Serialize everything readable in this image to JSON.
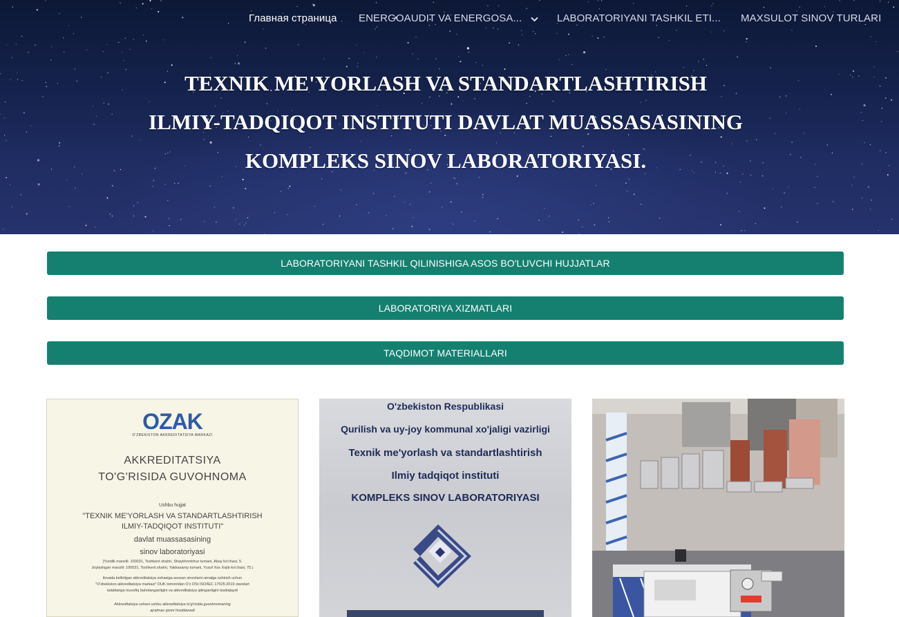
{
  "nav": {
    "items": [
      {
        "label": "Главная страница",
        "active": true
      },
      {
        "label": "ENERGOAUDIT VA ENERGOSA...",
        "dropdown": true
      },
      {
        "label": "LABORATORIYANI TASHKIL ETI..."
      },
      {
        "label": "MAXSULOT SINOV TURLARI"
      }
    ]
  },
  "hero": {
    "title_lines": [
      "TEXNIK ME'YORLASH VA STANDARTLASHTIRISH",
      "ILMIY-TADQIQOT INSTITUTI DAVLAT MUASSASASINING",
      "KOMPLEKS SINOV LABORATORIYASI."
    ]
  },
  "buttons": [
    "LABORATORIYANI TASHKIL QILINISHIGA ASOS BO'LUVCHI HUJJATLAR",
    "LABORATORIYA XIZMATLARI",
    "TAQDIMOT MATERIALLARI"
  ],
  "card_cert": {
    "logo": "OZAK",
    "logo_sub": "O'ZBEKISTON AKKREDITATSIYA MARKAZI",
    "title_1": "AKKREDITATSIYA",
    "title_2": "TO'G'RISIDA GUVOHNOMA",
    "line_1": "Ushbu hujjat",
    "line_2": "\"TEXNIK ME'YORLASH VA STANDARTLASHTIRISH",
    "line_3": "ILMIY-TADQIQOT INSTITUTI\"",
    "line_4": "davlat muassasasining",
    "line_5": "sinov laboratoriyasi",
    "line_6": "(Yuridik manzili: 100031, Toshkent shahri, Shaykhontohur tumani, Abay ko'chasi, 5.",
    "line_7": "Joylashgan manzili: 100031, Toshkent shahri, Yakkasaroy tumani, Yusuf Xos Xojib ko'chasi, 75.)",
    "line_8": "ilovada keltirilgan akkreditatsiya sohasiga asosan sinovlarni amalga oshirish uchun",
    "line_9": "\"O'zbekiston akkreditatsiya markazi\" DUK tomonidan O'z DSt ISO/IEC 17025:2019 standart",
    "line_10": "talablariga muvofiq baholanganligini va akkreditatsiya qilinganligini tasdiqlaydi",
    "line_11": "Akkreditatsiya sohasi ushbu akkreditatsiya to'g'risida guvohnomaning",
    "line_12": "ajralmas qismi hisoblanadi"
  },
  "card_sign": {
    "lines": [
      "O'zbekiston Respublikasi",
      "Qurilish va uy-joy kommunal xo'jaligi vazirligi",
      "Texnik me'yorlash va standartlashtirish",
      "Ilmiy tadqiqot instituti",
      "KOMPLEKS SINOV LABORATORIYASI"
    ]
  },
  "colors": {
    "button_bg": "#158070",
    "hero_bg": "#14214a",
    "logo_blue": "#2c5ca6",
    "logo_red": "#d62a30"
  }
}
